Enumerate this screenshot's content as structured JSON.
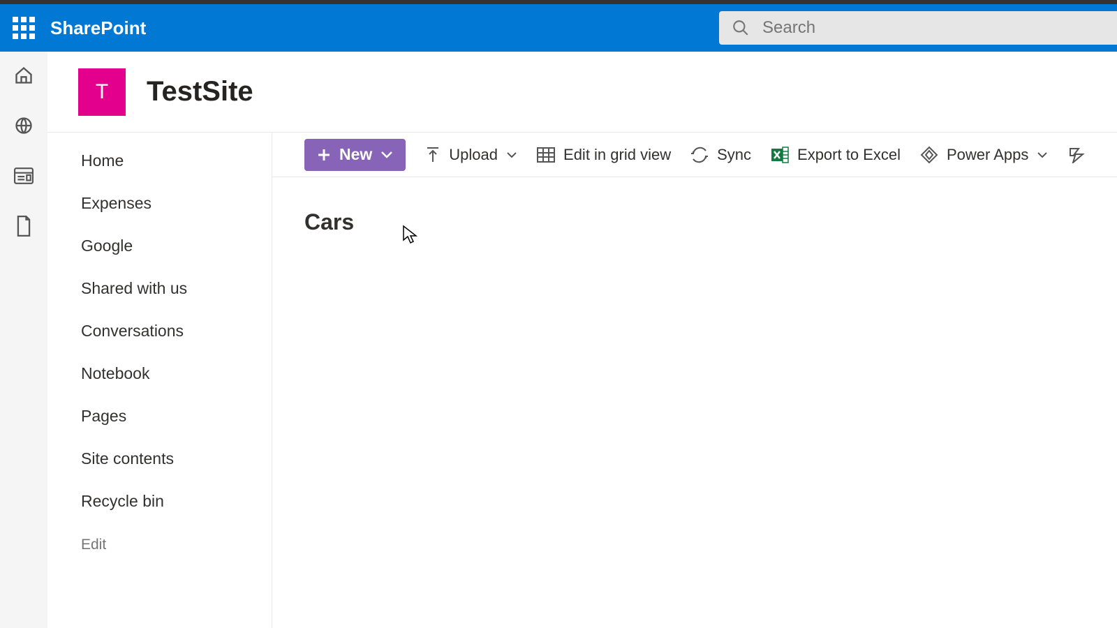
{
  "header": {
    "brand": "SharePoint",
    "search_placeholder": "Search"
  },
  "site": {
    "logo_initial": "T",
    "title": "TestSite"
  },
  "nav": {
    "items": [
      "Home",
      "Expenses",
      "Google",
      "Shared with us",
      "Conversations",
      "Notebook",
      "Pages",
      "Site contents",
      "Recycle bin"
    ],
    "edit_label": "Edit"
  },
  "commands": {
    "new_label": "New",
    "upload_label": "Upload",
    "edit_grid_label": "Edit in grid view",
    "sync_label": "Sync",
    "export_label": "Export to Excel",
    "powerapps_label": "Power Apps"
  },
  "list": {
    "title": "Cars"
  }
}
